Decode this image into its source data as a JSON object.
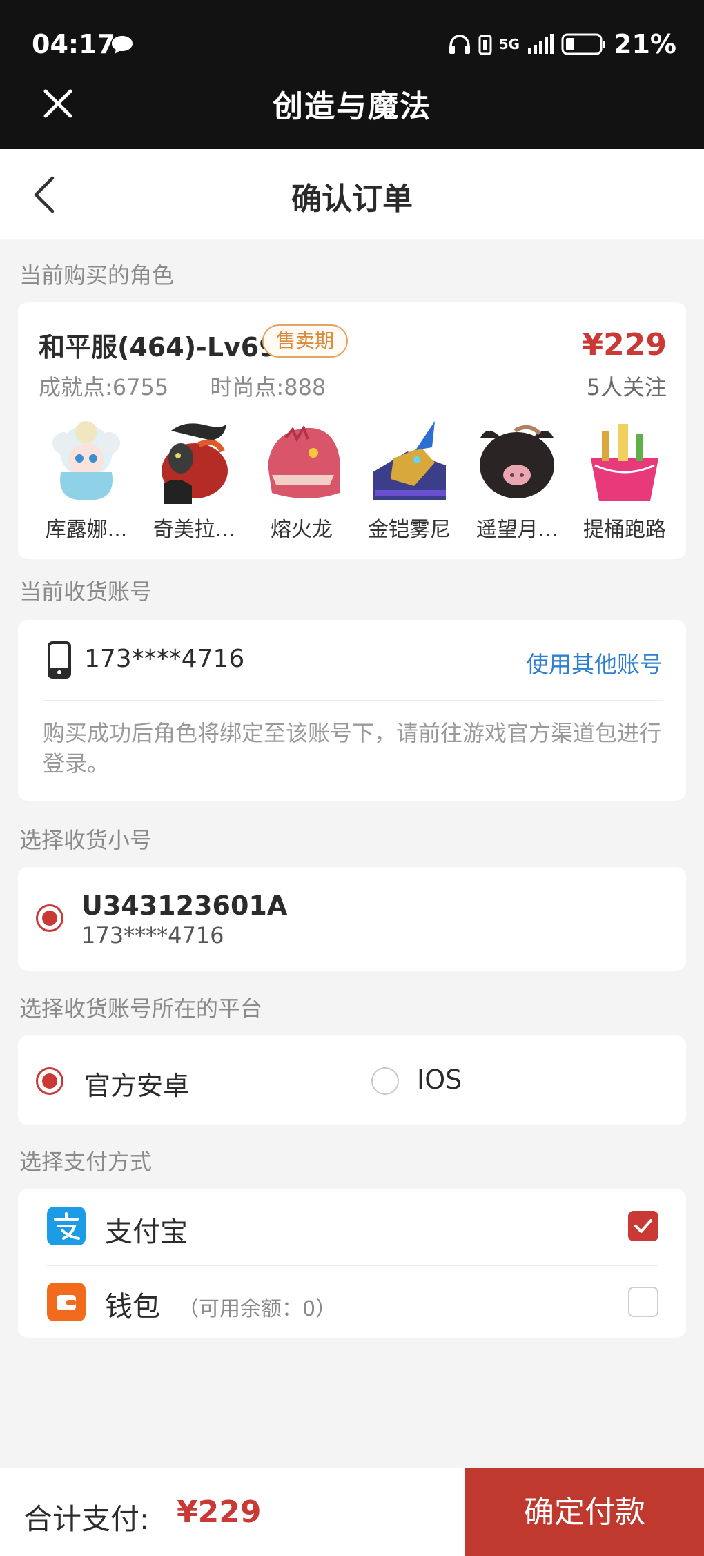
{
  "status_bar": {
    "time": "04:17",
    "network": "5G",
    "battery": "21%"
  },
  "title_bar": {
    "title": "创造与魔法"
  },
  "header": {
    "title": "确认订单"
  },
  "sections": {
    "role": "当前购买的角色",
    "account": "当前收货账号",
    "subaccount": "选择收货小号",
    "platform": "选择收货账号所在的平台",
    "payment": "选择支付方式"
  },
  "role": {
    "name": "和平服(464)-Lv69",
    "badge": "售卖期",
    "price": "¥229",
    "achievement_label": "成就点:",
    "achievement_value": "6755",
    "fashion_label": "时尚点:",
    "fashion_value": "888",
    "followers": "5人关注",
    "pets": [
      {
        "name": "库露娜...",
        "icon": "kuluna-pet-icon"
      },
      {
        "name": "奇美拉...",
        "icon": "chimera-pet-icon"
      },
      {
        "name": "熔火龙",
        "icon": "lava-dragon-pet-icon"
      },
      {
        "name": "金铠雾尼",
        "icon": "golden-armor-pet-icon"
      },
      {
        "name": "遥望月...",
        "icon": "moon-pig-pet-icon"
      },
      {
        "name": "提桶跑路",
        "icon": "bucket-pet-icon"
      }
    ]
  },
  "account": {
    "number": "173****4716",
    "other_link": "使用其他账号",
    "note": "购买成功后角色将绑定至该账号下，请前往游戏官方渠道包进行登录。"
  },
  "subaccount": {
    "id": "U343123601A",
    "phone": "173****4716"
  },
  "platform": {
    "options": [
      {
        "label": "官方安卓",
        "selected": true
      },
      {
        "label": "IOS",
        "selected": false
      }
    ]
  },
  "payment": {
    "methods": [
      {
        "label": "支付宝",
        "sub": "",
        "checked": true
      },
      {
        "label": "钱包",
        "sub": "（可用余额：0）",
        "checked": false
      }
    ]
  },
  "footer": {
    "total_label": "合计支付:",
    "total_amount": "¥229",
    "button": "确定付款"
  },
  "colors": {
    "accent_red": "#c93a36",
    "link_blue": "#2f7fd0",
    "badge_orange": "#d98a3a",
    "alipay_blue": "#1c9be6",
    "wallet_orange": "#f26a1b"
  }
}
